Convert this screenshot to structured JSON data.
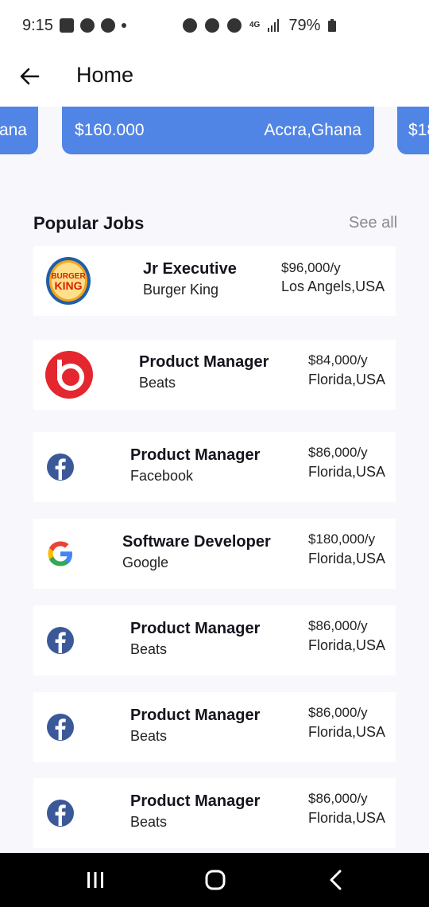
{
  "status_bar": {
    "time": "9:15",
    "battery": "79%",
    "network": "4G"
  },
  "app_bar": {
    "title": "Home"
  },
  "banners": [
    {
      "salary": "",
      "location": "ana"
    },
    {
      "salary": "$160.000",
      "location": "Accra,Ghana"
    },
    {
      "salary": "$18",
      "location": ""
    }
  ],
  "popular": {
    "title": "Popular Jobs",
    "see_all": "See all"
  },
  "jobs": [
    {
      "title": "Jr Executive",
      "company": "Burger King",
      "salary": "$96,000/y",
      "location": "Los Angels,USA",
      "logo": "burger-king-logo",
      "logo_text": "BURGER KING"
    },
    {
      "title": "Product Manager",
      "company": "Beats",
      "salary": "$84,000/y",
      "location": "Florida,USA",
      "logo": "beats-logo"
    },
    {
      "title": "Product Manager",
      "company": "Facebook",
      "salary": "$86,000/y",
      "location": "Florida,USA",
      "logo": "facebook-logo"
    },
    {
      "title": "Software Developer",
      "company": "Google",
      "salary": "$180,000/y",
      "location": "Florida,USA",
      "logo": "google-logo"
    },
    {
      "title": "Product Manager",
      "company": "Beats",
      "salary": "$86,000/y",
      "location": "Florida,USA",
      "logo": "facebook-logo"
    },
    {
      "title": "Product Manager",
      "company": "Beats",
      "salary": "$86,000/y",
      "location": "Florida,USA",
      "logo": "facebook-logo"
    },
    {
      "title": "Product Manager",
      "company": "Beats",
      "salary": "$86,000/y",
      "location": "Florida,USA",
      "logo": "facebook-logo"
    }
  ],
  "colors": {
    "accent": "#5085e6",
    "background": "#f8f8fc",
    "card": "#ffffff",
    "facebook": "#3b5998",
    "beats": "#e4262e"
  }
}
